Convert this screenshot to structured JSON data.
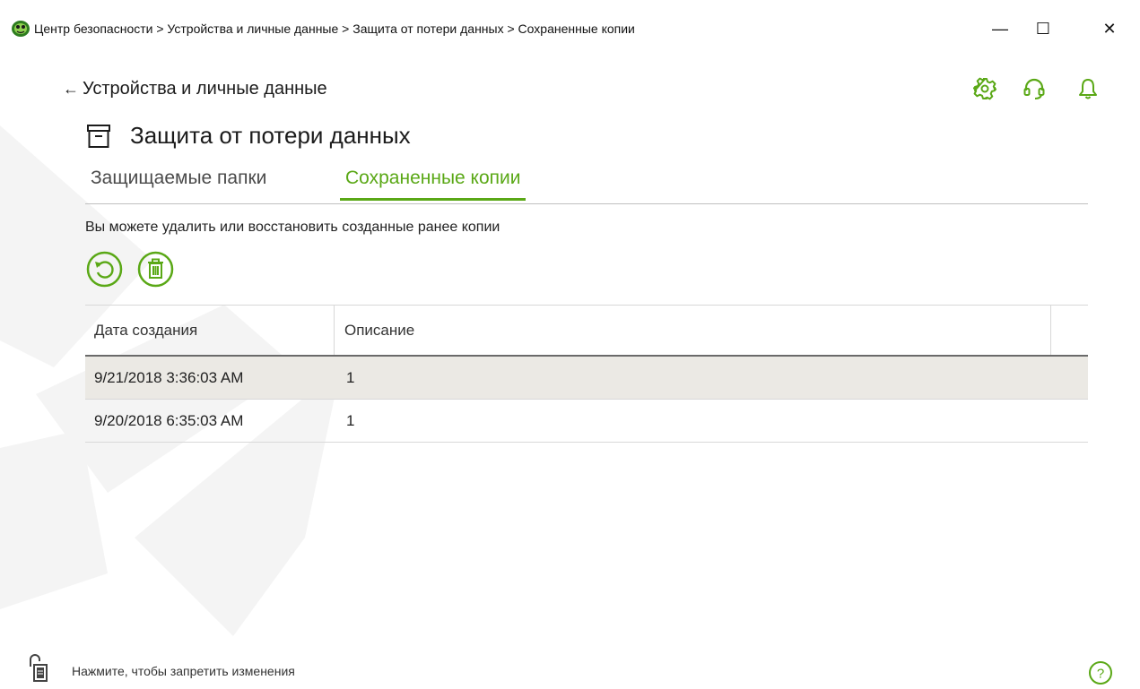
{
  "window": {
    "title": "Центр безопасности > Устройства и личные данные > Защита от потери данных > Сохраненные копии",
    "minimize_glyph": "—",
    "maximize_glyph": "☐",
    "close_glyph": "✕"
  },
  "header": {
    "back_label": "Устройства и личные данные",
    "icons": [
      "gear-icon",
      "support-headset-icon",
      "bell-icon"
    ]
  },
  "page": {
    "title": "Защита от потери данных",
    "icon": "archive-box-icon"
  },
  "tabs": [
    {
      "label": "Защищаемые папки",
      "active": false
    },
    {
      "label": "Сохраненные копии",
      "active": true
    }
  ],
  "description": "Вы можете удалить или восстановить созданные ранее копии",
  "actions": {
    "restore_icon": "restore-icon",
    "delete_icon": "trash-icon"
  },
  "table": {
    "columns": [
      "Дата создания",
      "Описание"
    ],
    "rows": [
      {
        "date": "9/21/2018 3:36:03 AM",
        "description": "1",
        "selected": true
      },
      {
        "date": "9/20/2018 6:35:03 AM",
        "description": "1",
        "selected": false
      }
    ]
  },
  "footer": {
    "lock_text": "Нажмите, чтобы запретить изменения",
    "help_icon": "help-icon"
  },
  "colors": {
    "accent": "#5aa816",
    "selected_row": "#ebe9e4",
    "text": "#222222"
  }
}
